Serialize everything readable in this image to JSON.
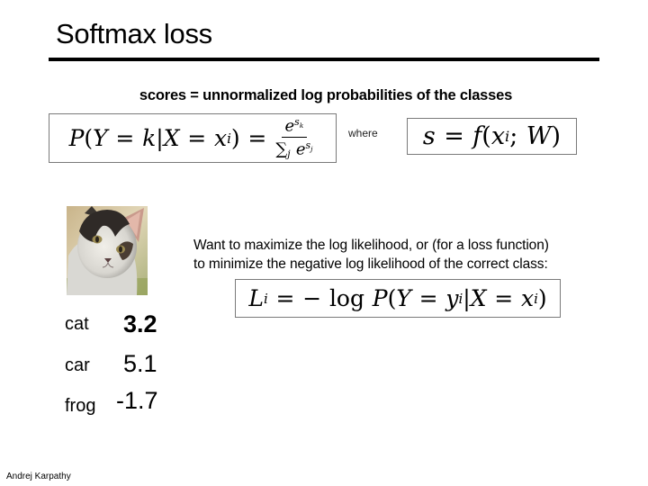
{
  "slide": {
    "title": "Softmax loss",
    "subtitle": "scores = unnormalized log probabilities of the classes",
    "where_label": "where",
    "description": {
      "line1": "Want to maximize the log likelihood, or (for a loss function)",
      "line2": "to minimize the negative log likelihood of the correct  class:"
    },
    "image": {
      "alt": "cat"
    },
    "classes": [
      {
        "label": "cat",
        "score": "3.2"
      },
      {
        "label": "car",
        "score": "5.1"
      },
      {
        "label": "frog",
        "score": "-1.7"
      }
    ],
    "author": "Andrej Karpathy"
  },
  "equations": {
    "softmax": "P(Y = k|X = x_i) = e^{s_k} / sum_j e^{s_j}",
    "score_function": "s = f(x_i; W)",
    "loss": "L_i = -log P(Y = y_i|X = x_i)"
  }
}
